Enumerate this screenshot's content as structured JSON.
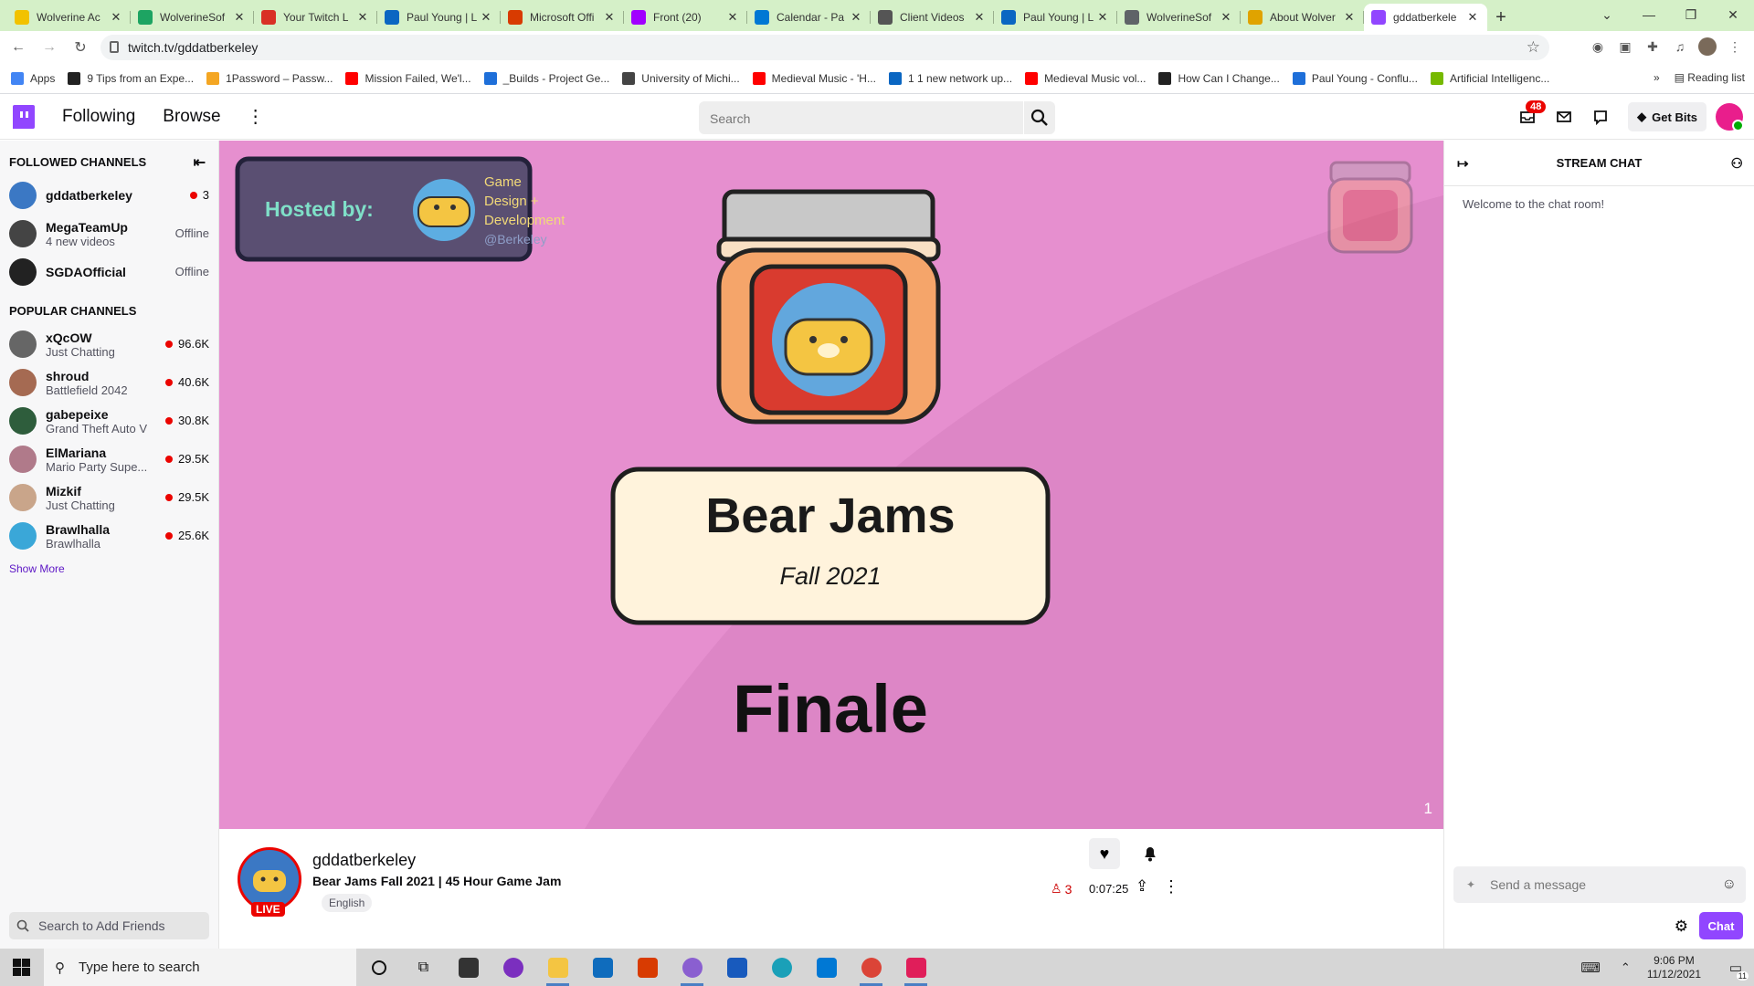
{
  "browser": {
    "tabs": [
      {
        "title": "Wolverine Ac",
        "color": "#f2c200"
      },
      {
        "title": "WolverineSof",
        "color": "#1da462"
      },
      {
        "title": "Your Twitch L",
        "color": "#d93025"
      },
      {
        "title": "Paul Young | L",
        "color": "#0a66c2"
      },
      {
        "title": "Microsoft Offi",
        "color": "#d83b01"
      },
      {
        "title": "Front (20)",
        "color": "#a100ff"
      },
      {
        "title": "Calendar - Pa",
        "color": "#0078d4"
      },
      {
        "title": "Client Videos",
        "color": "#555555"
      },
      {
        "title": "Paul Young | L",
        "color": "#0a66c2"
      },
      {
        "title": "WolverineSof",
        "color": "#5f6368"
      },
      {
        "title": "About Wolver",
        "color": "#e0a300"
      },
      {
        "title": "gddatberkele",
        "color": "#9146ff"
      }
    ],
    "url": "twitch.tv/gddatberkeley",
    "bookmarks": [
      {
        "label": "Apps",
        "color": "#4285f4"
      },
      {
        "label": "9 Tips from an Expe...",
        "color": "#222222"
      },
      {
        "label": "1Password – Passw...",
        "color": "#f4a623"
      },
      {
        "label": "Mission Failed, We'l...",
        "color": "#ff0000"
      },
      {
        "label": "_Builds - Project Ge...",
        "color": "#1e6fd9"
      },
      {
        "label": "University of Michi...",
        "color": "#444444"
      },
      {
        "label": "Medieval Music - 'H...",
        "color": "#ff0000"
      },
      {
        "label": "1 1 new network up...",
        "color": "#0a66c2"
      },
      {
        "label": "Medieval Music vol...",
        "color": "#ff0000"
      },
      {
        "label": "How Can I Change...",
        "color": "#222222"
      },
      {
        "label": "Paul Young - Conflu...",
        "color": "#1e6fd9"
      },
      {
        "label": "Artificial Intelligenc...",
        "color": "#76b900"
      }
    ],
    "more": "»",
    "reading_list": "Reading list"
  },
  "twitch": {
    "nav": {
      "following": "Following",
      "browse": "Browse"
    },
    "search_placeholder": "Search",
    "notif_count": "48",
    "get_bits": "Get Bits",
    "sidebar": {
      "followed_title": "FOLLOWED CHANNELS",
      "followed": [
        {
          "name": "gddatberkeley",
          "sub": "",
          "viewers": "3",
          "live": true,
          "color": "#3b78c4"
        },
        {
          "name": "MegaTeamUp",
          "sub": "4 new videos",
          "viewers": "Offline",
          "live": false,
          "color": "#444444"
        },
        {
          "name": "SGDAOfficial",
          "sub": "",
          "viewers": "Offline",
          "live": false,
          "color": "#222222"
        }
      ],
      "popular_title": "POPULAR CHANNELS",
      "popular": [
        {
          "name": "xQcOW",
          "sub": "Just Chatting",
          "viewers": "96.6K",
          "color": "#666666"
        },
        {
          "name": "shroud",
          "sub": "Battlefield 2042",
          "viewers": "40.6K",
          "color": "#a56a52"
        },
        {
          "name": "gabepeixe",
          "sub": "Grand Theft Auto V",
          "viewers": "30.8K",
          "color": "#2e5d3c"
        },
        {
          "name": "ElMariana",
          "sub": "Mario Party Supe...",
          "viewers": "29.5K",
          "color": "#b07a8a"
        },
        {
          "name": "Mizkif",
          "sub": "Just Chatting",
          "viewers": "29.5K",
          "color": "#c9a58a"
        },
        {
          "name": "Brawlhalla",
          "sub": "Brawlhalla",
          "viewers": "25.6K",
          "color": "#3aa7d8"
        }
      ],
      "show_more": "Show More",
      "friends_placeholder": "Search to Add Friends"
    },
    "stream": {
      "hosted_by": "Hosted by:",
      "host_line1": "Game",
      "host_line2": "Design +",
      "host_line3": "Development",
      "host_line4": "@Berkeley",
      "jam_title": "Bear Jams",
      "jam_sub": "Fall 2021",
      "finale": "Finale",
      "corner_num": "1"
    },
    "info": {
      "channel": "gddatberkeley",
      "title": "Bear Jams Fall 2021 | 45 Hour Game Jam",
      "tag": "English",
      "live": "LIVE",
      "viewers": "3",
      "uptime": "0:07:25"
    },
    "chat": {
      "header": "STREAM CHAT",
      "welcome": "Welcome to the chat room!",
      "placeholder": "Send a message",
      "button": "Chat"
    }
  },
  "taskbar": {
    "search_placeholder": "Type here to search",
    "time": "9:06 PM",
    "date": "11/12/2021",
    "notif": "11"
  }
}
